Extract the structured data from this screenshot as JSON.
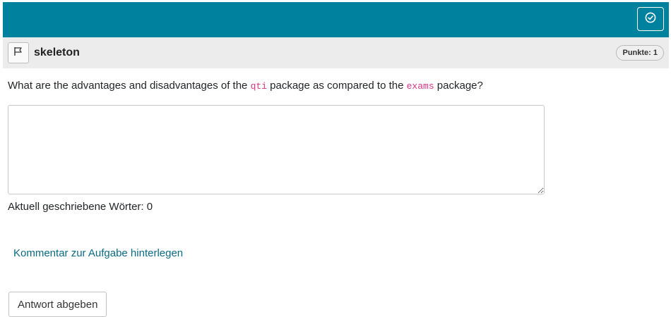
{
  "topbar": {
    "submit_icon": "check-circle-icon",
    "accent_color": "#00819e"
  },
  "question": {
    "flag_icon": "flag-icon",
    "title": "skeleton",
    "points_label": "Punkte: 1",
    "text_before": "What are the advantages and disadvantages of the ",
    "code1": "qti",
    "text_middle": " package as compared to the ",
    "code2": "exams",
    "text_after": " package?"
  },
  "answer": {
    "value": "",
    "word_count_label": "Aktuell geschriebene Wörter: 0"
  },
  "comment_link": "Kommentar zur Aufgabe hinterlegen",
  "submit_button": "Antwort abgeben"
}
